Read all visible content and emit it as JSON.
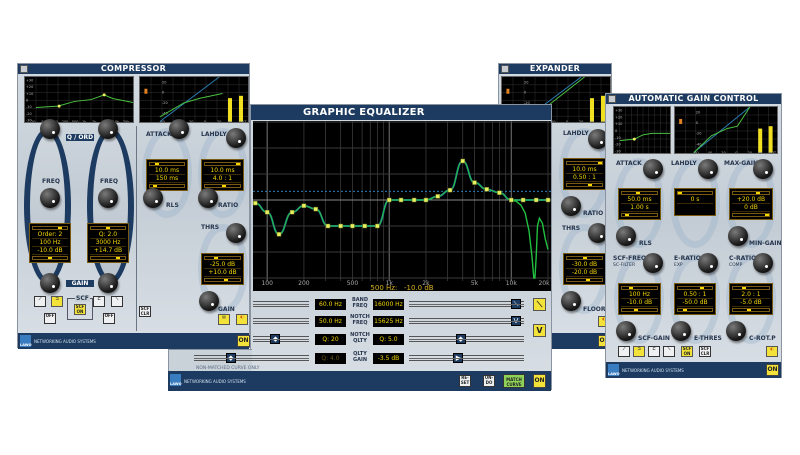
{
  "brand": {
    "logo": "LAWO",
    "tagline": "NETWORKING AUDIO SYSTEMS"
  },
  "colors": {
    "titlebar": "#1d3b60",
    "display_text": "#f5d800",
    "curve": "#22c040",
    "point": "#e8f060",
    "reference": "#2a7ab0"
  },
  "compressor": {
    "title": "COMPRESSOR",
    "graph_eq": {
      "y_ticks": [
        "+30",
        "+20",
        "+10",
        "0",
        "-10",
        "-20",
        "-30"
      ],
      "x_ticks": [
        "20",
        "50",
        "100",
        "200",
        "500",
        "1k",
        "2k",
        "5k",
        "10k",
        "20k"
      ]
    },
    "graph_dyn": {
      "y_ticks": [
        "20",
        "0",
        "-20",
        "-40"
      ],
      "x_ticks": [
        "-60",
        "-40",
        "-20",
        "0",
        "20"
      ],
      "meter_labels": [
        "IN",
        "OUT"
      ]
    },
    "q_ord": "Q / ORD",
    "freq1": "FREQ",
    "freq2": "FREQ",
    "gain_tag": "GAIN",
    "band1": {
      "values": [
        "Order: 2",
        "100 Hz",
        "-10.0 dB"
      ],
      "levels": [
        0.8,
        0.5
      ]
    },
    "band2": {
      "values": [
        "Q: 2.0",
        "3000 Hz",
        "+14.7 dB"
      ],
      "levels": [
        0.5,
        0.8
      ]
    },
    "scf": "SCF",
    "scf_on": "SCF ON",
    "off1": "OFF",
    "off2": "OFF",
    "scf_clr": "SCF CLR",
    "attack": "ATTACK",
    "lahdly": "LAHDLY",
    "rls": "RLS",
    "ratio": "RATIO",
    "thrs": "THRS",
    "gain": "GAIN",
    "attack_disp": {
      "values": [
        "10.0 ms",
        "150 ms"
      ],
      "levels": [
        0.2,
        0.15
      ]
    },
    "lahdly_disp": {
      "values": [
        "10.0 ms",
        "4.0 : 1"
      ],
      "levels": [
        0.95,
        0.55
      ]
    },
    "thrs_disp": {
      "values": [
        "-25.0 dB",
        "+10.0 dB"
      ],
      "levels": [
        0.3,
        0.6
      ]
    },
    "on": "ON"
  },
  "expander": {
    "title": "EXPANDER",
    "lahdly": "LAHDLY",
    "ratio": "RATIO",
    "thrs": "THRS",
    "floor": "FLOOR",
    "lahdly_disp": {
      "values": [
        "10.0 ms",
        "0.50 : 1"
      ],
      "levels": [
        0.95,
        0.65
      ]
    },
    "thrs_disp": {
      "values": [
        "-30.0 dB",
        "-20.0 dB"
      ],
      "levels": [
        0.5,
        0.6
      ]
    },
    "on": "ON"
  },
  "agc": {
    "title": "AUTOMATIC GAIN CONTROL",
    "attack": "ATTACK",
    "lahdly": "LAHDLY",
    "max_gain": "MAX-GAIN",
    "rls": "RLS",
    "min_gain": "MIN-GAIN",
    "scf_freq": "SCF-FREQ",
    "scf_freq_sub": "SC-FILTER",
    "e_ratio": "E-RATIO",
    "e_ratio_sub": "EXP",
    "c_ratio": "C-RATIO",
    "c_ratio_sub": "COMP",
    "scf_gain": "SCF-GAIN",
    "e_thres": "E-THRES",
    "c_rotp": "C-ROT.P",
    "attack_disp": {
      "values": [
        "50.0 ms",
        "1.00 s"
      ],
      "levels": [
        0.45,
        0.15
      ]
    },
    "lahdly_disp": {
      "values": [
        "0 s"
      ],
      "levels": [
        0.05
      ]
    },
    "max_gain_disp": {
      "values": [
        "+20.0 dB",
        "0 dB"
      ],
      "levels": [
        0.7,
        0.95
      ]
    },
    "scf_disp": {
      "values": [
        "100 Hz",
        "-10.0 dB"
      ],
      "levels": [
        0.25,
        0.4
      ]
    },
    "e_ratio_disp": {
      "values": [
        "0.50 : 1",
        "-50.0 dB"
      ],
      "levels": [
        0.7,
        0.2
      ]
    },
    "c_ratio_disp": {
      "values": [
        "2.0 : 1",
        "-5.0 dB"
      ],
      "levels": [
        0.3,
        0.45
      ]
    },
    "scf_on": "SCF ON",
    "scf_clr": "SCF CLR",
    "on": "ON"
  },
  "equalizer": {
    "title": "GRAPHIC EQUALIZER",
    "readout": "500 Hz:   -10.0 dB",
    "rows": [
      {
        "left_value": "60.0 Hz",
        "label": "BAND FREQ",
        "right_value": "16000 Hz",
        "left_slider": 0.0,
        "right_slider": 0.93,
        "right_thumb_icon": "lowpass-icon"
      },
      {
        "left_value": "50.0 Hz",
        "label": "NOTCH FREQ",
        "right_value": "15625 Hz",
        "left_slider": 0.0,
        "right_slider": 0.93,
        "right_thumb_icon": "notch-icon"
      },
      {
        "left_value": "Q: 20",
        "label": "NOTCH QLTY",
        "right_value": "Q: 5.0",
        "left_slider": 0.4,
        "right_slider": 0.45
      },
      {
        "left_value": "Q: 4.0",
        "label": "QLTY GAIN",
        "right_value": "-3.5 dB",
        "left_slider": 0.32,
        "right_slider": 0.43
      }
    ],
    "non_matched": "NON-MATCHED CURVE ONLY",
    "reset": "RE- SET",
    "undo": "UN- DO",
    "match_curve": "MATCH CURVE",
    "on": "ON"
  },
  "chart_data": {
    "type": "line",
    "x_scale": "log",
    "xlim": [
      78,
      20000
    ],
    "ylim": [
      -30,
      30
    ],
    "grid": true,
    "x_tick_labels": [
      "100",
      "200",
      "500",
      "1k",
      "2k",
      "5k",
      "10k",
      "20k"
    ],
    "x_ticks": [
      100,
      200,
      500,
      1000,
      2000,
      5000,
      10000,
      20000
    ],
    "reference_line_db": 3.3,
    "band_points": {
      "x": [
        80,
        100,
        125,
        160,
        200,
        250,
        315,
        400,
        500,
        630,
        800,
        1000,
        1250,
        1600,
        2000,
        2500,
        3150,
        4000,
        5000,
        6300,
        8000,
        10000,
        12500,
        16000,
        20000
      ],
      "y": [
        -1.2,
        -4.7,
        -13.2,
        -4.7,
        -2.2,
        -3.5,
        -10,
        -10,
        -10,
        -10,
        -10,
        0,
        0,
        0,
        0,
        1.4,
        3.8,
        15,
        6.7,
        4.1,
        2.8,
        0,
        0,
        0,
        0
      ]
    },
    "notch_curve": {
      "x": [
        10000,
        11000,
        12000,
        13000,
        14000,
        14800,
        15300,
        15625,
        16000,
        16400,
        17000,
        18000,
        19000,
        20000
      ],
      "y": [
        0,
        -0.5,
        -2,
        -5,
        -12,
        -22,
        -30,
        -30,
        -22,
        -10,
        -7,
        -9,
        -15,
        -19
      ]
    }
  }
}
